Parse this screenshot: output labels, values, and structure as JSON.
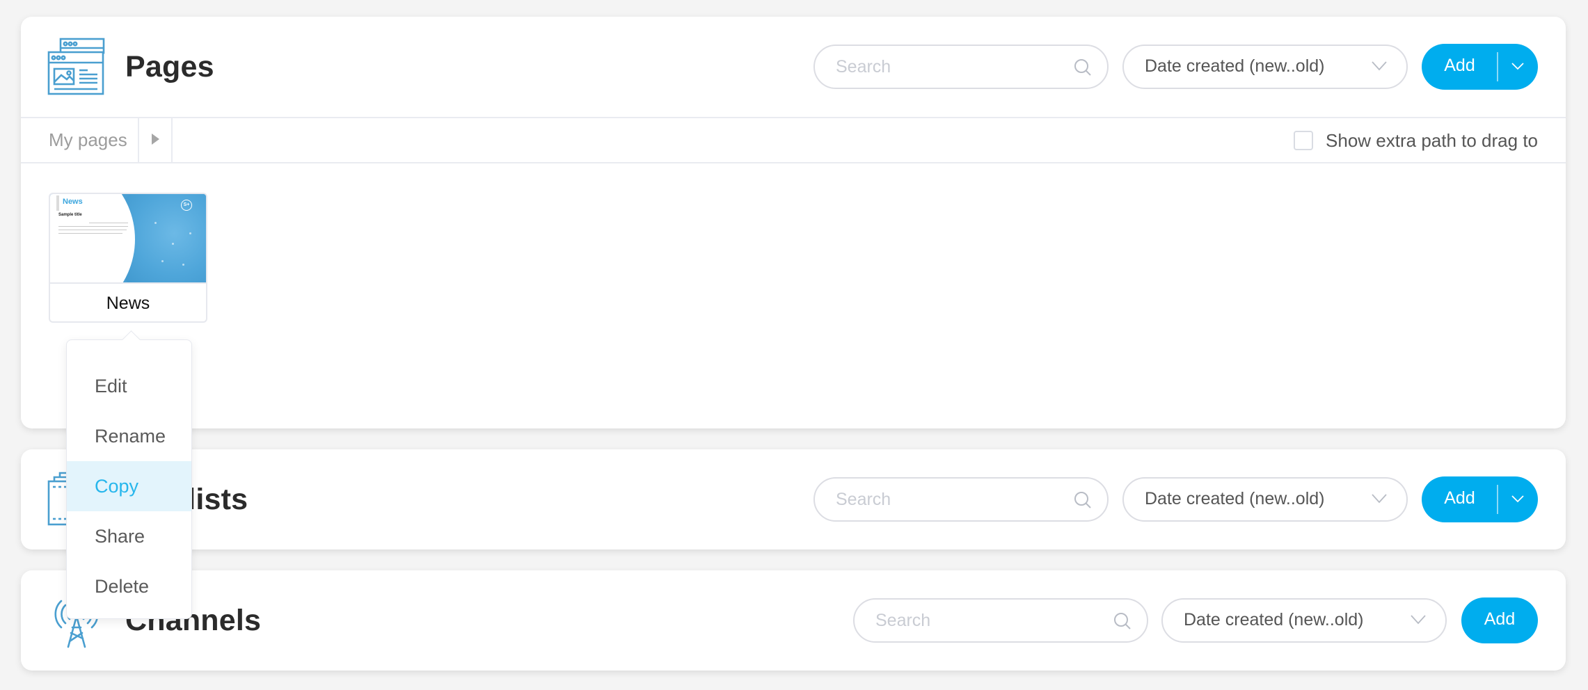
{
  "colors": {
    "accent": "#00adee",
    "icon_blue": "#4a9fd0",
    "menu_highlight_bg": "#e3f4fc",
    "menu_highlight_text": "#27b6ec",
    "page_bg": "#f4f4f4"
  },
  "panels": {
    "pages": {
      "title": "Pages",
      "icon": "web-pages-icon",
      "search_placeholder": "Search",
      "search_value": "",
      "sort_selected": "Date created (new..old)",
      "add_label": "Add",
      "add_has_dropdown": true,
      "breadcrumb": {
        "root": "My pages",
        "arrow_icon": "caret-right-icon"
      },
      "extra_path": {
        "label": "Show extra path to drag to",
        "checked": false
      },
      "items": [
        {
          "name": "News",
          "thumbnail": {
            "heading": "News",
            "subtitle": "Sample title",
            "logo": "S+"
          }
        }
      ]
    },
    "playlists": {
      "title": "Playlists",
      "title_visible": "sts",
      "icon": "film-strip-icon",
      "search_placeholder": "Search",
      "search_value": "",
      "sort_selected": "Date created (new..old)",
      "add_label": "Add",
      "add_has_dropdown": true
    },
    "channels": {
      "title": "Channels",
      "icon": "broadcast-tower-icon",
      "search_placeholder": "Search",
      "search_value": "",
      "sort_selected": "Date created (new..old)",
      "add_label": "Add",
      "add_has_dropdown": false
    }
  },
  "context_menu": {
    "items": [
      {
        "label": "Edit",
        "active": false
      },
      {
        "label": "Rename",
        "active": false
      },
      {
        "label": "Copy",
        "active": true
      },
      {
        "label": "Share",
        "active": false
      },
      {
        "label": "Delete",
        "active": false
      }
    ]
  }
}
